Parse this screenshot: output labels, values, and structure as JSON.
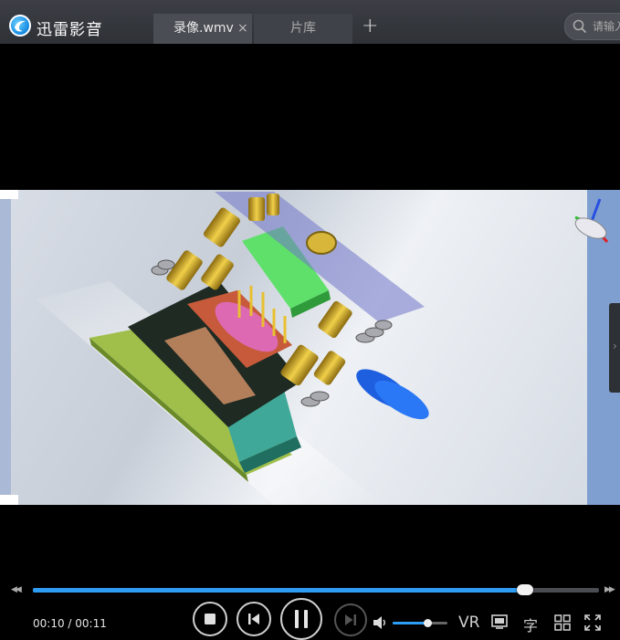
{
  "app": {
    "name": "迅雷影音",
    "caret": "▾"
  },
  "tabs": [
    {
      "label": "录像.wmv",
      "close": "×"
    },
    {
      "label": "片库"
    }
  ],
  "tab_add": "+",
  "search": {
    "placeholder": "请输入"
  },
  "side_handle": "›",
  "player": {
    "seek_back": "◀◀",
    "seek_forward": "▶▶",
    "progress_fraction": 0.87,
    "timecode": "00:10 / 00:11",
    "volume_fraction": 0.64,
    "vr_label": "VR",
    "subtitle_label": "字"
  },
  "colors": {
    "accent": "#2f9cf4",
    "titlebar": "#3c3f45"
  }
}
